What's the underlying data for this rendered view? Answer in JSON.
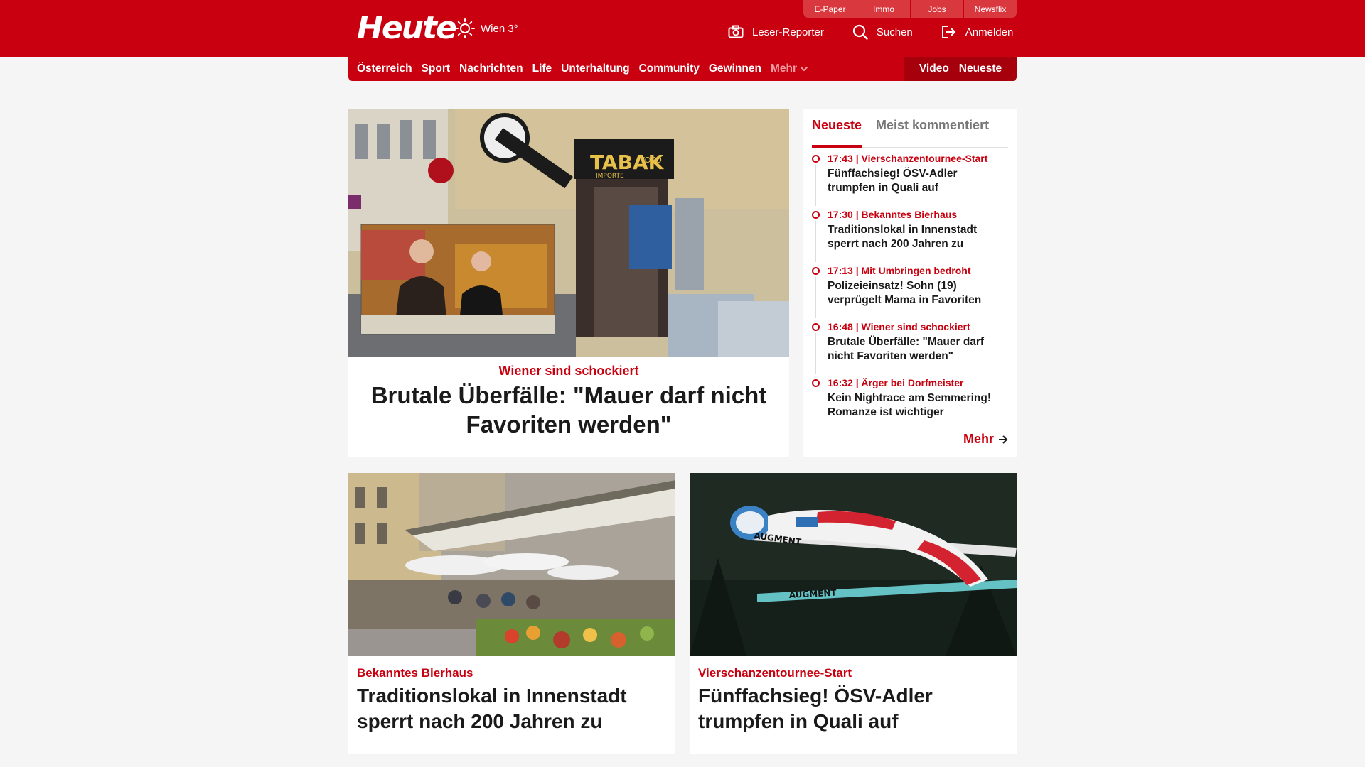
{
  "header": {
    "logo": "Heute",
    "weather": "Wien 3°",
    "util_tabs": [
      "E-Paper",
      "Immo",
      "Jobs",
      "Newsflix"
    ],
    "actions": {
      "reporter": "Leser-Reporter",
      "search": "Suchen",
      "login": "Anmelden"
    }
  },
  "nav": {
    "items": [
      "Österreich",
      "Sport",
      "Nachrichten",
      "Life",
      "Unterhaltung",
      "Community",
      "Gewinnen"
    ],
    "more": "Mehr",
    "right": [
      "Video",
      "Neueste"
    ]
  },
  "hero": {
    "kicker": "Wiener sind schockiert",
    "title": "Brutale Überfälle: \"Mauer darf nicht Favoriten werden\""
  },
  "sidebar": {
    "tabs": [
      "Neueste",
      "Meist kommentiert"
    ],
    "items": [
      {
        "meta": "17:43 | Vierschanzentournee-Start",
        "title": "Fünffachsieg! ÖSV-Adler trumpfen in Quali auf"
      },
      {
        "meta": "17:30 | Bekanntes Bierhaus",
        "title": "Traditionslokal in Innenstadt sperrt nach 200 Jahren zu"
      },
      {
        "meta": "17:13 | Mit Umbringen bedroht",
        "title": "Polizeieinsatz! Sohn (19) verprügelt Mama in Favoriten"
      },
      {
        "meta": "16:48 | Wiener sind schockiert",
        "title": "Brutale Überfälle: \"Mauer darf nicht Favoriten werden\""
      },
      {
        "meta": "16:32 | Ärger bei Dorfmeister",
        "title": "Kein Nightrace am Semmering! Romanze ist wichtiger"
      }
    ],
    "more": "Mehr"
  },
  "cards": [
    {
      "kicker": "Bekanntes Bierhaus",
      "title": "Traditionslokal in Innenstadt sperrt nach 200 Jahren zu"
    },
    {
      "kicker": "Vierschanzentournee-Start",
      "title": "Fünffachsieg! ÖSV-Adler trumpfen in Quali auf"
    }
  ],
  "hero_image_text": {
    "sign": "TABAK",
    "sign_sub": "IMPORTE",
    "toto": "TOTO"
  },
  "card_image_text": {
    "ski": "AUGMENT"
  },
  "colors": {
    "brand_red": "#c8000f",
    "dark_red": "#a6000c"
  }
}
